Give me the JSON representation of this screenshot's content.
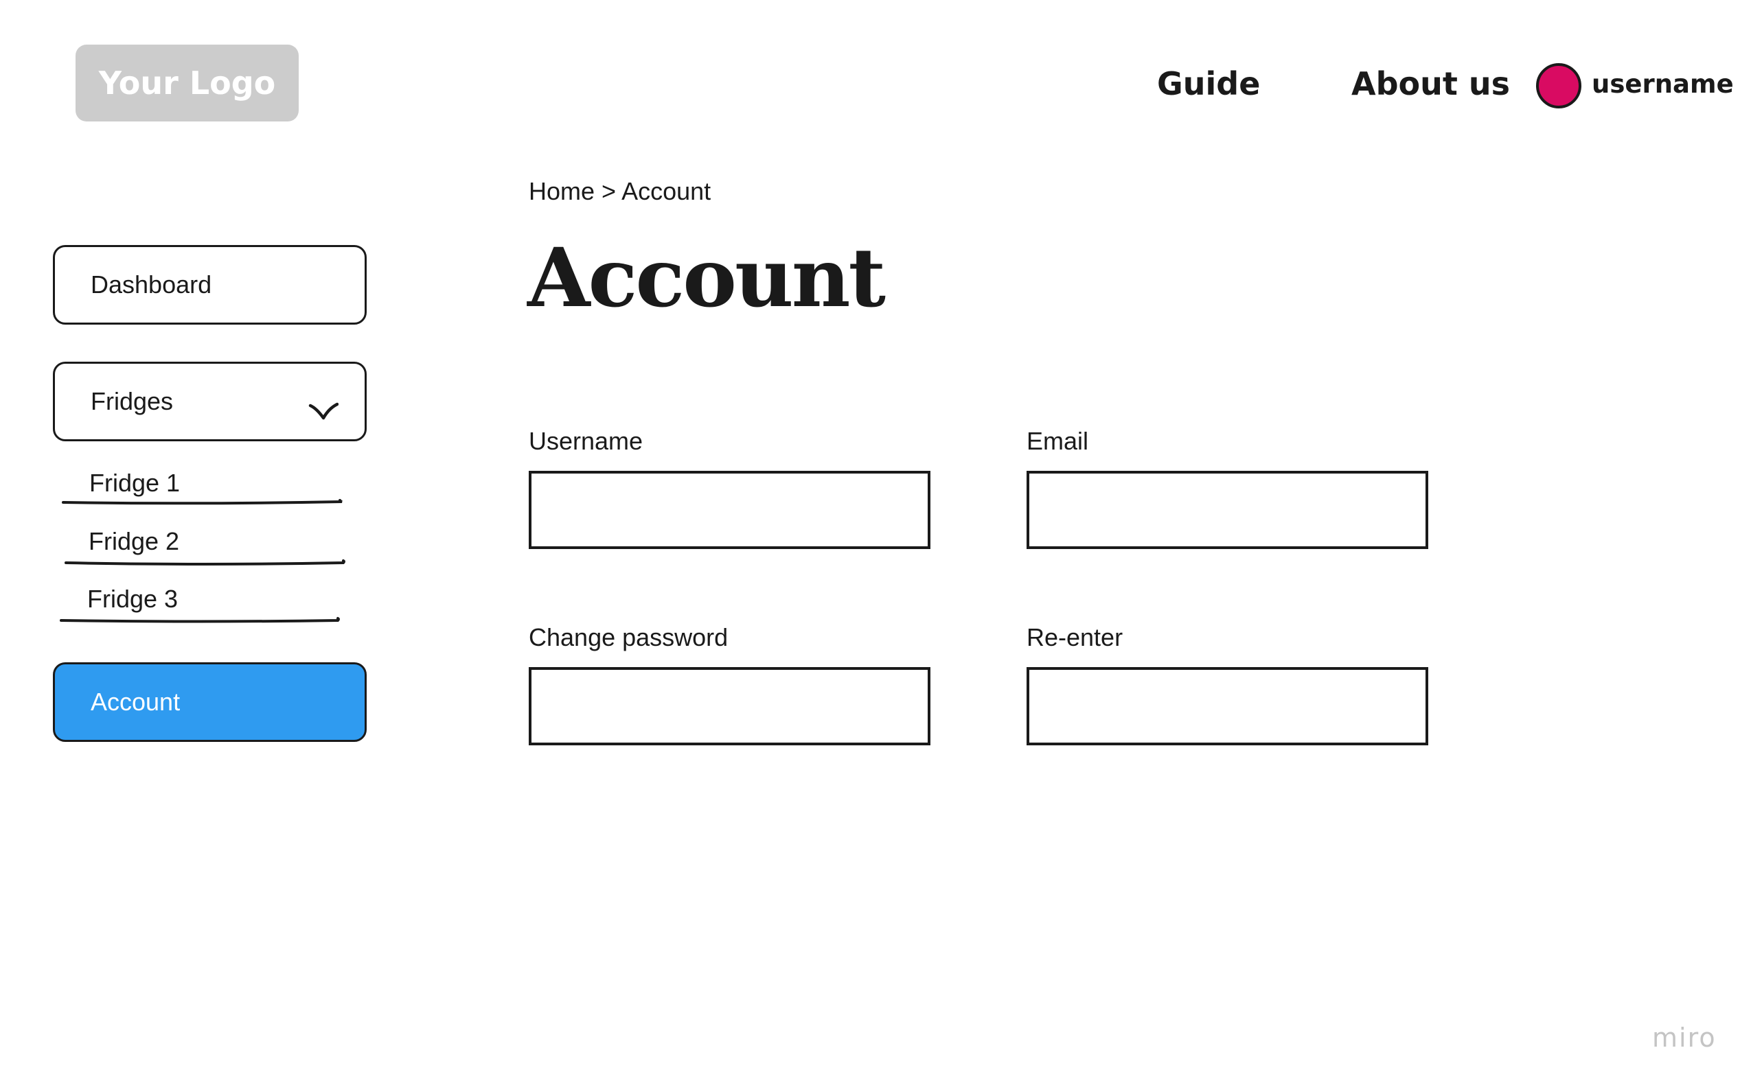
{
  "header": {
    "logo_text": "Your Logo",
    "nav": {
      "guide": "Guide",
      "about": "About us"
    },
    "user": {
      "username": "username",
      "avatar_color": "#d90b62"
    }
  },
  "sidebar": {
    "dashboard": "Dashboard",
    "fridges": "Fridges",
    "fridge_items": [
      "Fridge 1",
      "Fridge 2",
      "Fridge 3"
    ],
    "account": "Account",
    "active_color": "#2f9bf0"
  },
  "main": {
    "breadcrumb": "Home > Account",
    "title": "Account",
    "form": {
      "username_label": "Username",
      "username_value": "",
      "email_label": "Email",
      "email_value": "",
      "password_label": "Change password",
      "password_value": "",
      "reenter_label": "Re-enter",
      "reenter_value": ""
    }
  },
  "watermark": "miro"
}
